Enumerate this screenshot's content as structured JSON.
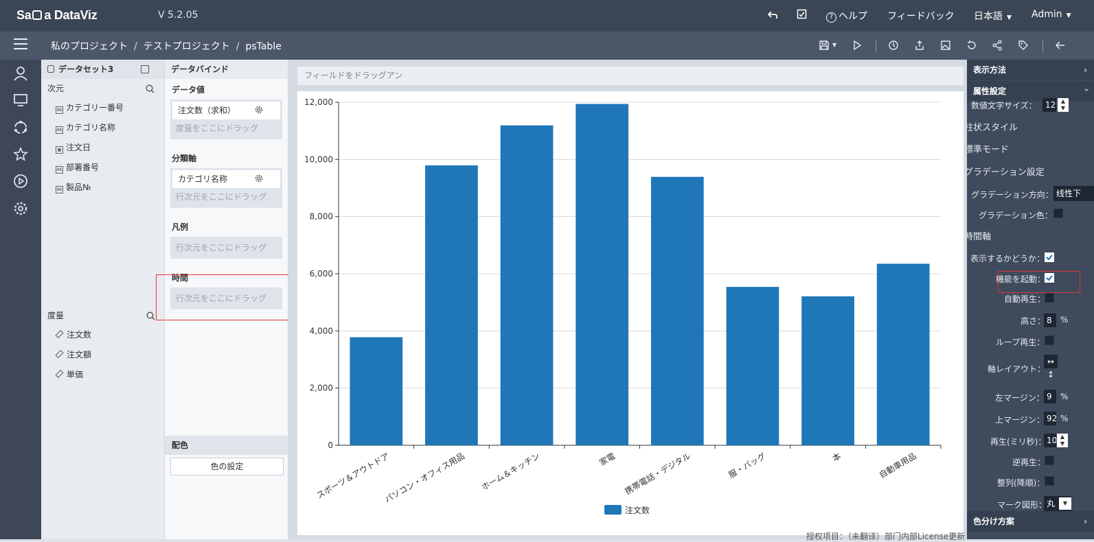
{
  "app": {
    "brand": "Sa",
    "brand_rest": "DataViz",
    "version": "V 5.2.05"
  },
  "topbar": {
    "help": "ヘルプ",
    "feedback": "フィードバック",
    "language": "日本語",
    "user": "Admin"
  },
  "breadcrumb": [
    "私のプロジェクト",
    "テストプロジェクト",
    "psTable"
  ],
  "dataset": {
    "title": "データセット3",
    "dimension_label": "次元",
    "dimensions": [
      "カテゴリー番号",
      "カテゴリ名称",
      "注文日",
      "部署番号",
      "製品№"
    ],
    "measure_label": "度量",
    "measures": [
      "注文数",
      "注文額",
      "単価"
    ]
  },
  "binding": {
    "title": "データバインド",
    "value_label": "データ値",
    "value_field": "注文数（求和）",
    "value_hint": "度量をここにドラッグ",
    "category_label": "分類軸",
    "category_field": "カテゴリ名称",
    "category_hint": "行次元をここにドラッグ",
    "legend_label": "凡例",
    "legend_hint": "行次元をここにドラッグ",
    "time_label": "時間",
    "time_hint": "行次元をここにドラッグ",
    "color_label": "配色",
    "color_button": "色の設定"
  },
  "canvas": {
    "drag_hint": "フィールドをドラッグアン"
  },
  "chart_data": {
    "type": "bar",
    "categories": [
      "スポーツ＆アウトドア",
      "パソコン・オフィス用品",
      "ホーム＆キッチン",
      "家電",
      "携帯電話・デジタル",
      "服・バッグ",
      "本",
      "自動車用品"
    ],
    "series": [
      {
        "name": "注文数",
        "values": [
          3780,
          9790,
          11190,
          11940,
          9390,
          5540,
          5210,
          6350
        ],
        "color": "#1f77b8"
      }
    ],
    "yticks": [
      "0",
      "2,000",
      "4,000",
      "6,000",
      "8,000",
      "10,000",
      "12,000"
    ],
    "ylim": [
      0,
      12000
    ],
    "grid": true,
    "legend": "bottom-center",
    "xlabel": "",
    "ylabel": ""
  },
  "props": {
    "display_method": "表示方法",
    "attr_settings": "属性設定",
    "font_size_label": "数値文字サイズ：",
    "font_size_value": "12",
    "bar_style": "柱状スタイル",
    "standard_mode": "標準モード",
    "gradient_settings": "グラデーション設定",
    "gradient_dir_label": "グラデーション方向：",
    "gradient_dir_value": "线性下",
    "gradient_color_label": "グラデーション色：",
    "time_axis": "時間軸",
    "show_label": "表示するかどうか：",
    "enable_label": "機能を起動：",
    "autoplay_label": "自動再生：",
    "height_label": "高さ：",
    "height_value": "8",
    "percent": "%",
    "loop_label": "ループ再生：",
    "axis_layout_label": "軸レイアウト：",
    "left_margin_label": "左マージン：",
    "left_margin_value": "9",
    "top_margin_label": "上マージン：",
    "top_margin_value": "92",
    "play_ms_label": "再生(ミリ秒)：",
    "play_ms_value": "10",
    "reverse_label": "逆再生：",
    "sort_label": "整列(降順)：",
    "mark_label": "マーク図形：",
    "mark_value": "丸",
    "color_scheme": "色分け方案"
  },
  "footer": {
    "note": "授权项目：（未翻译）部门内部License更新"
  }
}
